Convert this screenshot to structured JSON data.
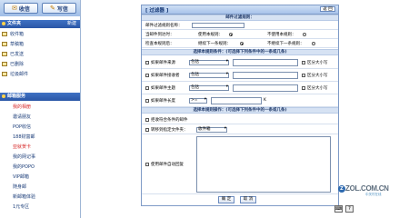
{
  "toolbar": {
    "receive_label": "收信",
    "compose_label": "写信"
  },
  "folders_panel": {
    "title": "文件夹",
    "action": "新建",
    "items": [
      {
        "label": "收件箱"
      },
      {
        "label": "草稿箱"
      },
      {
        "label": "已发送"
      },
      {
        "label": "已删除"
      },
      {
        "label": "垃圾邮件"
      }
    ]
  },
  "services_panel": {
    "title": "邮箱服务",
    "items": [
      {
        "label": "我的相册"
      },
      {
        "label": "邀请朋友"
      },
      {
        "label": "POP收信"
      },
      {
        "label": "188财富邮"
      },
      {
        "label": "亚就贺卡"
      },
      {
        "label": "我的网记事"
      },
      {
        "label": "我的POPO"
      },
      {
        "label": "VIP邮箱"
      },
      {
        "label": "随身邮"
      },
      {
        "label": "新邮箱体验"
      },
      {
        "label": "1元专区"
      }
    ]
  },
  "filter_panel": {
    "title": "[ 过滤器 ]",
    "back_label": "返 回",
    "rule_section": "邮件过滤规则：",
    "rule_name_label": "邮件过滤规则名称：",
    "arrival_label": "当邮件到达时：",
    "use_rule_label": "使用本规则：",
    "no_use_rule_label": "不使用本规则：",
    "check_label": "检查本规则后：",
    "continue_label": "继续下一条规则：",
    "stop_label": "不继续下一条规则：",
    "conditions_section": "选择本规则条件：(可选择下列条件中的一条或几条)",
    "conditions": [
      {
        "label": "如果邮件来源",
        "operator": "包括",
        "extra": "区分大小写"
      },
      {
        "label": "如果邮件接收者",
        "operator": "包括",
        "extra": "区分大小写"
      },
      {
        "label": "如果邮件主题",
        "operator": "包括",
        "extra": "区分大小写"
      },
      {
        "label": "如果邮件长度",
        "operator": ">=",
        "unit": "K"
      }
    ],
    "actions_section": "选择本规则操作：(可选择下列条件中的一条或几条)",
    "actions": [
      {
        "label": "拒收符合条件的邮件"
      },
      {
        "label": "转移到指定文件夹：",
        "folder": "收件箱"
      },
      {
        "label": "使用邮件自动回复"
      }
    ],
    "ok_label": "确 定",
    "cancel_label": "取 消"
  },
  "watermark": {
    "logo": "ZOL.COM.CN",
    "subtitle": "中关村在线"
  }
}
